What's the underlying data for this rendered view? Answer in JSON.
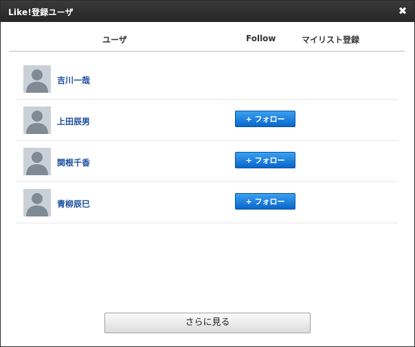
{
  "dialog": {
    "title": "Like!登録ユーザ",
    "close_glyph": "✖"
  },
  "columns": {
    "user": "ユーザ",
    "follow": "Follow",
    "mylist": "マイリスト登録"
  },
  "users": [
    {
      "name": "吉川一哉",
      "follow_label": ""
    },
    {
      "name": "上田辰男",
      "follow_label": "+ フォロー"
    },
    {
      "name": "関根千香",
      "follow_label": "+ フォロー"
    },
    {
      "name": "青柳辰巳",
      "follow_label": "+ フォロー"
    }
  ],
  "more_button": "さらに見る",
  "colors": {
    "titlebar": "#2e2e2e",
    "name_link": "#1b4da0",
    "follow_button": "#1a7fe0"
  },
  "icons": {
    "close": "close-icon",
    "avatar": "default-avatar-icon"
  }
}
